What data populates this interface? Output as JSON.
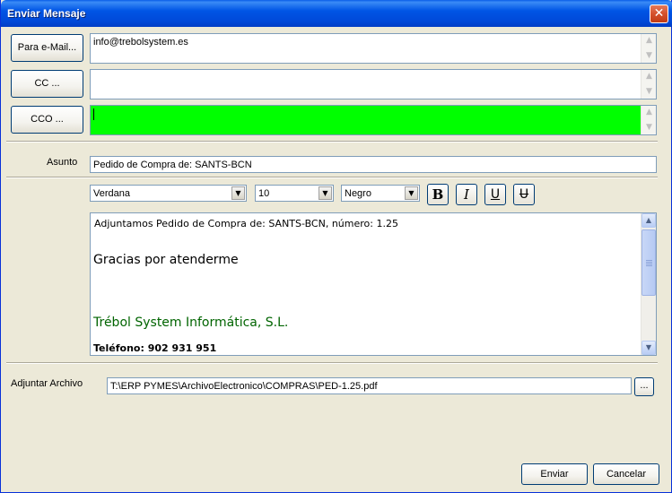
{
  "window": {
    "title": "Enviar Mensaje",
    "close_glyph": "✕"
  },
  "recipients": {
    "to": {
      "button": "Para e-Mail...",
      "value": "info@trebolsystem.es"
    },
    "cc": {
      "button": "CC ...",
      "value": ""
    },
    "cco": {
      "button": "CCO ...",
      "value": ""
    }
  },
  "subject": {
    "label": "Asunto",
    "value": "Pedido de Compra de: SANTS-BCN"
  },
  "toolbar": {
    "font": "Verdana",
    "size": "10",
    "color": "Negro",
    "bold_icon": "B",
    "italic_icon": "I",
    "underline_icon": "U",
    "strike_icon": "U"
  },
  "body": {
    "line1": "Adjuntamos Pedido de Compra de: SANTS-BCN, número: 1.25",
    "line2": "Gracias por atenderme",
    "line3": "Trébol System Informática, S.L.",
    "line4": "Teléfono: 902 931 951"
  },
  "attachment": {
    "label": "Adjuntar Archivo",
    "value": "T:\\ERP PYMES\\ArchivoElectronico\\COMPRAS\\PED-1.25.pdf",
    "browse": "..."
  },
  "actions": {
    "send": "Enviar",
    "cancel": "Cancelar"
  },
  "colors": {
    "cco_field": "#00FF00",
    "signature": "#006400",
    "titlebar": "#0055E5"
  }
}
